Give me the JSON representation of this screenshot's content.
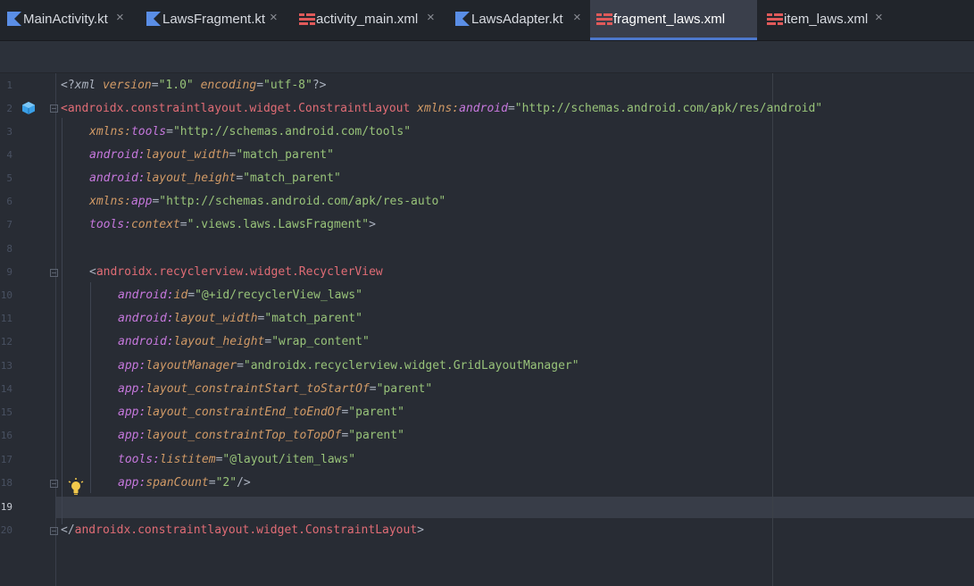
{
  "tabs": [
    {
      "label": "MainActivity.kt",
      "type": "kotlin",
      "active": false
    },
    {
      "label": "LawsFragment.kt",
      "type": "kotlin",
      "active": false
    },
    {
      "label": "activity_main.xml",
      "type": "layout",
      "active": false
    },
    {
      "label": "LawsAdapter.kt",
      "type": "kotlin",
      "active": false
    },
    {
      "label": "fragment_laws.xml",
      "type": "layout",
      "active": true
    },
    {
      "label": "item_laws.xml",
      "type": "layout",
      "active": false
    }
  ],
  "close_glyph": "×",
  "current_line": 19,
  "lines": [
    {
      "n": "1"
    },
    {
      "n": "2"
    },
    {
      "n": "3"
    },
    {
      "n": "4"
    },
    {
      "n": "5"
    },
    {
      "n": "6"
    },
    {
      "n": "7"
    },
    {
      "n": "8"
    },
    {
      "n": "9"
    },
    {
      "n": "10"
    },
    {
      "n": "11"
    },
    {
      "n": "12"
    },
    {
      "n": "13"
    },
    {
      "n": "14"
    },
    {
      "n": "15"
    },
    {
      "n": "16"
    },
    {
      "n": "17"
    },
    {
      "n": "18"
    },
    {
      "n": "19"
    },
    {
      "n": "20"
    }
  ],
  "code": {
    "l1": {
      "a": "<?",
      "b": "xml ",
      "c": "version",
      "d": "=",
      "e": "\"1.0\" ",
      "f": "encoding",
      "g": "=",
      "h": "\"utf-8\"",
      "i": "?>"
    },
    "l2": {
      "a": "<",
      "b": "androidx.constraintlayout.widget.ConstraintLayout ",
      "c": "xmlns:",
      "d": "android",
      "e": "=",
      "f": "\"http://schemas.android.com/apk/res/android\""
    },
    "l3": {
      "a": "xmlns:",
      "b": "tools",
      "c": "=",
      "d": "\"http://schemas.android.com/tools\""
    },
    "l4": {
      "a": "android:",
      "b": "layout_width",
      "c": "=",
      "d": "\"match_parent\""
    },
    "l5": {
      "a": "android:",
      "b": "layout_height",
      "c": "=",
      "d": "\"match_parent\""
    },
    "l6": {
      "a": "xmlns:",
      "b": "app",
      "c": "=",
      "d": "\"http://schemas.android.com/apk/res-auto\""
    },
    "l7": {
      "a": "tools:",
      "b": "context",
      "c": "=",
      "d": "\".views.laws.LawsFragment\"",
      "e": ">"
    },
    "l9": {
      "a": "<",
      "b": "androidx.recyclerview.widget.RecyclerView"
    },
    "l10": {
      "a": "android:",
      "b": "id",
      "c": "=",
      "d": "\"@+id/recyclerView_laws\""
    },
    "l11": {
      "a": "android:",
      "b": "layout_width",
      "c": "=",
      "d": "\"match_parent\""
    },
    "l12": {
      "a": "android:",
      "b": "layout_height",
      "c": "=",
      "d": "\"wrap_content\""
    },
    "l13": {
      "a": "app:",
      "b": "layoutManager",
      "c": "=",
      "d": "\"androidx.recyclerview.widget.GridLayoutManager\""
    },
    "l14": {
      "a": "app:",
      "b": "layout_constraintStart_toStartOf",
      "c": "=",
      "d": "\"parent\""
    },
    "l15": {
      "a": "app:",
      "b": "layout_constraintEnd_toEndOf",
      "c": "=",
      "d": "\"parent\""
    },
    "l16": {
      "a": "app:",
      "b": "layout_constraintTop_toTopOf",
      "c": "=",
      "d": "\"parent\""
    },
    "l17": {
      "a": "tools:",
      "b": "listitem",
      "c": "=",
      "d": "\"@layout/item_laws\""
    },
    "l18": {
      "a": "app:",
      "b": "spanCount",
      "c": "=",
      "d": "\"2\"",
      "e": "/>"
    },
    "l20": {
      "a": "</",
      "b": "androidx.constraintlayout.widget.ConstraintLayout",
      "c": ">"
    }
  },
  "colors": {
    "tag": "#e06c75",
    "namespace": "#c678dd",
    "attr": "#d19a66",
    "string": "#98c379",
    "accent": "#4d78cc"
  },
  "icons": {
    "kotlin": "kotlin-file-icon",
    "layout": "layout-xml-icon",
    "gutter_component": "component-cube-icon",
    "intention": "lightbulb-icon"
  }
}
